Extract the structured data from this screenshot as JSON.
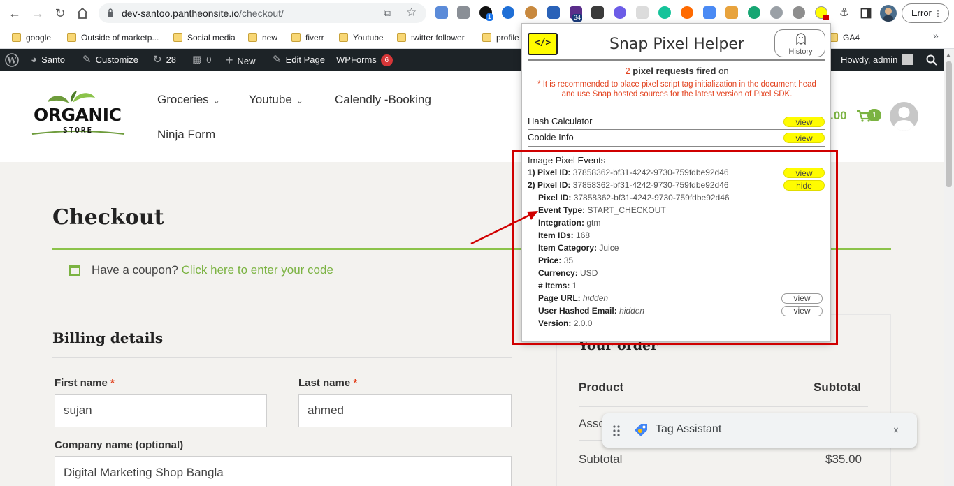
{
  "browser": {
    "url_host": "dev-santoo.pantheonsite.io",
    "url_path": "/checkout/",
    "ext_badge_1": "1",
    "ext_badge_2": "34",
    "error_label": "Error"
  },
  "bookmarks": [
    {
      "label": "google"
    },
    {
      "label": "Outside of marketp..."
    },
    {
      "label": "Social media"
    },
    {
      "label": "new"
    },
    {
      "label": "fiverr"
    },
    {
      "label": "Youtube"
    },
    {
      "label": "twitter follower"
    },
    {
      "label": "profile"
    },
    {
      "label": "GA4"
    }
  ],
  "admin_bar": {
    "site": "Santo",
    "customize": "Customize",
    "updates": "28",
    "comments": "0",
    "new": "New",
    "edit_page": "Edit Page",
    "wpforms": "WPForms",
    "wpforms_count": "6",
    "howdy": "Howdy, admin"
  },
  "header": {
    "logo_line1": "ORGANIC",
    "logo_line2": "STORE",
    "menu": [
      "Groceries",
      "Youtube",
      "Calendly -Booking",
      "Ninja Form"
    ],
    "cart_total": ".00",
    "cart_count": "1"
  },
  "page": {
    "title": "Checkout",
    "coupon_text": "Have a coupon?",
    "coupon_link": "Click here to enter your code",
    "billing_title": "Billing details",
    "first_name_label": "First name",
    "last_name_label": "Last name",
    "required_mark": "*",
    "first_name": "sujan",
    "last_name": "ahmed",
    "company_label": "Company name (optional)",
    "company": "Digital Marketing Shop Bangla"
  },
  "order": {
    "title": "Your order",
    "col_product": "Product",
    "col_subtotal": "Subtotal",
    "row_product": "Asso",
    "subtotal_label": "Subtotal",
    "subtotal_value": "$35.00"
  },
  "tag_assistant": {
    "title": "Tag Assistant"
  },
  "snap": {
    "logo_text": "</>",
    "title": "Snap Pixel Helper",
    "history_label": "History",
    "pixel_count": "2",
    "pixel_count_label": "pixel requests fired",
    "pixel_count_suffix": "on",
    "warning": "* It is recommended to place pixel script tag initialization in the document head and use Snap hosted sources for the latest version of Pixel SDK.",
    "hash_calculator": "Hash Calculator",
    "cookie_info": "Cookie Info",
    "view": "view",
    "hide": "hide",
    "events_title": "Image Pixel Events",
    "event1_label": "1) Pixel ID:",
    "event1_value": "37858362-bf31-4242-9730-759fdbe92d46",
    "event2_label": "2) Pixel ID:",
    "event2_value": "37858362-bf31-4242-9730-759fdbe92d46",
    "details": [
      {
        "label": "Pixel ID:",
        "value": "37858362-bf31-4242-9730-759fdbe92d46"
      },
      {
        "label": "Event Type:",
        "value": "START_CHECKOUT"
      },
      {
        "label": "Integration:",
        "value": "gtm"
      },
      {
        "label": "Item IDs:",
        "value": "168"
      },
      {
        "label": "Item Category:",
        "value": "Juice"
      },
      {
        "label": "Price:",
        "value": "35"
      },
      {
        "label": "Currency:",
        "value": "USD"
      },
      {
        "label": "# Items:",
        "value": "1"
      },
      {
        "label": "Page URL:",
        "value": "hidden"
      },
      {
        "label": "User Hashed Email:",
        "value": "hidden"
      },
      {
        "label": "Version:",
        "value": "2.0.0"
      }
    ]
  },
  "colors": {
    "accent_green": "#7bb342",
    "snap_yellow": "#fffc00",
    "admin_bar": "#1d2327",
    "annotation_red": "#d00000"
  }
}
